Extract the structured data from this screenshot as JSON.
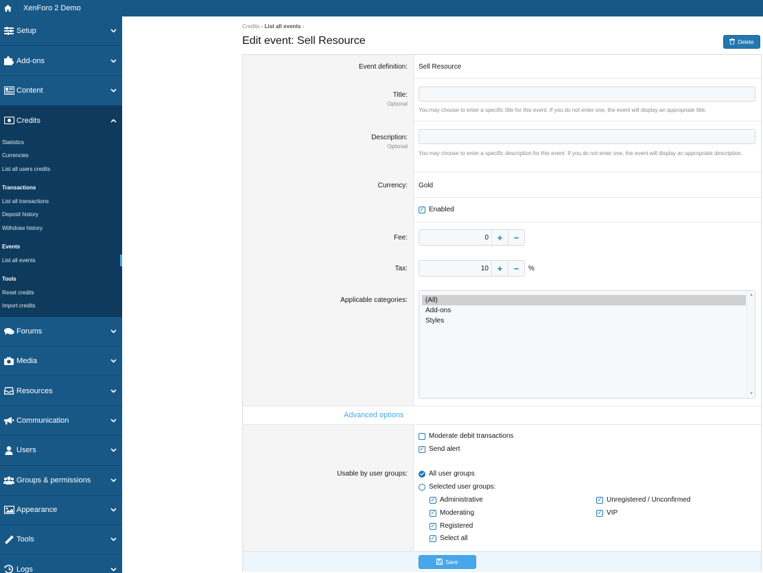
{
  "topbar": {
    "brand": "XenForo 2 Demo"
  },
  "sidebar": {
    "sections_top": [
      {
        "label": "Setup",
        "icon": "sliders-icon"
      },
      {
        "label": "Add-ons",
        "icon": "puzzle-icon"
      },
      {
        "label": "Content",
        "icon": "newspaper-icon"
      }
    ],
    "credits": {
      "label": "Credits",
      "groups": [
        {
          "heading": "",
          "items": [
            "Statistics",
            "Currencies",
            "List all users credits"
          ]
        },
        {
          "heading": "Transactions",
          "items": [
            "List all transactions",
            "Deposit history",
            "Withdraw history"
          ]
        },
        {
          "heading": "Events",
          "items": [
            "List all events"
          ]
        },
        {
          "heading": "Tools",
          "items": [
            "Reset credits",
            "Import credits"
          ]
        }
      ]
    },
    "sections_bottom": [
      {
        "label": "Forums",
        "icon": "comments-icon"
      },
      {
        "label": "Media",
        "icon": "camera-icon"
      },
      {
        "label": "Resources",
        "icon": "inbox-icon"
      },
      {
        "label": "Communication",
        "icon": "bullhorn-icon"
      },
      {
        "label": "Users",
        "icon": "user-icon"
      },
      {
        "label": "Groups & permissions",
        "icon": "users-icon"
      },
      {
        "label": "Appearance",
        "icon": "image-icon"
      },
      {
        "label": "Tools",
        "icon": "wrench-icon"
      },
      {
        "label": "Logs",
        "icon": "history-icon"
      }
    ]
  },
  "breadcrumb": {
    "first": "Credits",
    "sep": "›",
    "second": "List all events"
  },
  "page_title": "Edit event: Sell Resource",
  "delete_label": "Delete",
  "form": {
    "event_definition": {
      "label": "Event definition:",
      "value": "Sell Resource"
    },
    "title": {
      "label": "Title:",
      "hint": "Optional",
      "value": "",
      "explain": "You may choose to enter a specific title for this event. If you do not enter one, the event will display an appropriate title."
    },
    "description": {
      "label": "Description:",
      "hint": "Optional",
      "value": "",
      "explain": "You may choose to enter a specific description for this event. If you do not enter one, the event will display an appropriate description."
    },
    "currency": {
      "label": "Currency:",
      "value": "Gold"
    },
    "enabled": {
      "label": "Enabled",
      "checked": true
    },
    "fee": {
      "label": "Fee:",
      "value": "0"
    },
    "tax": {
      "label": "Tax:",
      "value": "10",
      "unit": "%"
    },
    "categories": {
      "label": "Applicable categories:",
      "options": [
        "(All)",
        "Add-ons",
        "Styles"
      ],
      "selected": "(All)"
    },
    "advanced_label": "Advanced options",
    "moderate": {
      "label": "Moderate debit transactions",
      "checked": false
    },
    "send_alert": {
      "label": "Send alert",
      "checked": true
    },
    "usable_by": {
      "label": "Usable by user groups:",
      "all": "All user groups",
      "selected": "Selected user groups:",
      "groups_left": [
        "Administrative",
        "Moderating",
        "Registered",
        "Select all"
      ],
      "groups_right": [
        "Unregistered / Unconfirmed",
        "VIP"
      ]
    },
    "save_label": "Save"
  },
  "colors": {
    "sidebar": "#185886",
    "accent": "#47a7eb",
    "button": "#2577b1"
  }
}
